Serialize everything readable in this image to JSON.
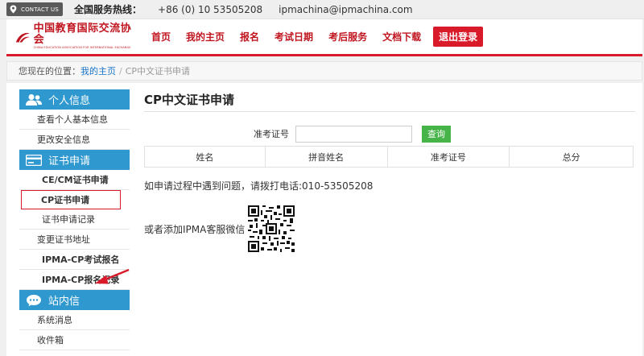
{
  "topbar": {
    "contact_badge": "CONTACT US",
    "hotline_label": "全国服务热线：",
    "hotline_number": "+86 (0) 10 53505208",
    "email": "ipmachina@ipmachina.com"
  },
  "header": {
    "logo_cn": "中国教育国际交流协会",
    "logo_en": "CHINA EDUCATION ASSOCIATION FOR INTERNATIONAL EXCHANGE",
    "nav": [
      {
        "label": "首页"
      },
      {
        "label": "我的主页"
      },
      {
        "label": "报名"
      },
      {
        "label": "考试日期"
      },
      {
        "label": "考后服务"
      },
      {
        "label": "文档下载"
      }
    ],
    "logout_label": "退出登录"
  },
  "breadcrumb": {
    "prefix": "您现在的位置：",
    "home": "我的主页",
    "sep": "/",
    "current": "CP中文证书申请"
  },
  "sidebar": {
    "personal": {
      "title": "个人信息",
      "items": [
        {
          "label": "查看个人基本信息"
        },
        {
          "label": "更改安全信息"
        }
      ]
    },
    "cert": {
      "title": "证书申请",
      "items": [
        {
          "label": "CE/CM证书申请"
        },
        {
          "label": "CP证书申请"
        },
        {
          "label": "证书申请记录"
        },
        {
          "label": "变更证书地址"
        },
        {
          "label": "IPMA-CP考试报名"
        },
        {
          "label": "IPMA-CP报名记录"
        }
      ]
    },
    "message": {
      "title": "站内信",
      "items": [
        {
          "label": "系统消息"
        },
        {
          "label": "收件箱"
        }
      ]
    }
  },
  "main": {
    "title": "CP中文证书申请",
    "search_label": "准考证号",
    "search_value": "",
    "search_button": "查询",
    "columns": [
      "姓名",
      "拼音姓名",
      "准考证号",
      "总分"
    ],
    "note": "如申请过程中遇到问题，请拨打电话:010-53505208",
    "wechat_text": "或者添加IPMA客服微信"
  },
  "colors": {
    "brand_red": "#d91a2a",
    "sidebar_blue": "#2f98cf",
    "button_green": "#47b44a",
    "link_blue": "#1874c8"
  },
  "icons": {
    "contact": "location-pin-icon",
    "personal": "users-icon",
    "cert": "card-icon",
    "message": "chat-bubble-icon"
  }
}
